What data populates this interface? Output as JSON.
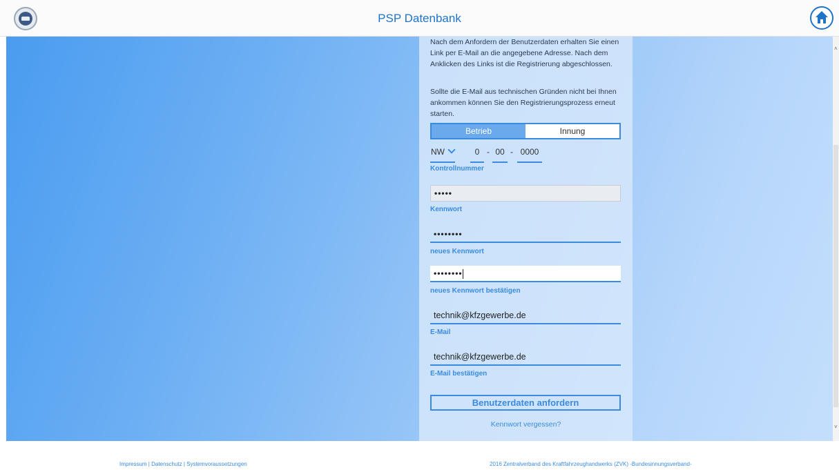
{
  "header": {
    "title": "PSP Datenbank",
    "logo_icon": "association-logo-icon",
    "home_icon": "home-icon"
  },
  "info": {
    "paragraph1": "Nach dem Anfordern der Benutzerdaten erhalten Sie einen Link per E-Mail an die angegebene Adresse. Nach dem Anklicken des Links ist die Registrierung abgeschlossen.",
    "paragraph2": "Sollte die E-Mail aus technischen Gründen nicht bei Ihnen ankommen können Sie den Registrierungsprozess erneut starten."
  },
  "segment": {
    "options": [
      "Betrieb",
      "Innung"
    ],
    "selected": "Betrieb"
  },
  "control_number": {
    "region": "NW",
    "part1": "0",
    "sep1": "-",
    "part2": "00",
    "sep2": "-",
    "part3": "0000",
    "label": "Kontrollnummer"
  },
  "password": {
    "value": "•••••",
    "label": "Kennwort"
  },
  "new_password": {
    "value": "••••••••",
    "label": "neues Kennwort"
  },
  "confirm_password": {
    "value": "••••••••",
    "label": "neues Kennwort bestätigen"
  },
  "email": {
    "value": "technik@kfzgewerbe.de",
    "label": "E-Mail"
  },
  "confirm_email": {
    "value": "technik@kfzgewerbe.de",
    "label": "E-Mail bestätigen"
  },
  "actions": {
    "submit_label": "Benutzerdaten anfordern",
    "forgot_label": "Kennwort vergessen?"
  },
  "footer": {
    "impressum": "Impressum",
    "sep": "|",
    "datenschutz": "Datenschutz",
    "systemvoraussetzungen": "Systemvoraussetzungen",
    "copyright": "2016 Zentralverband des Kraftfahrzeughandwerks (ZVK) -Bundesinnungsverband-"
  },
  "colors": {
    "accent": "#3a8be0",
    "title": "#1f73c8",
    "background_start": "#4a9cf0",
    "background_end": "#c4dffc"
  }
}
